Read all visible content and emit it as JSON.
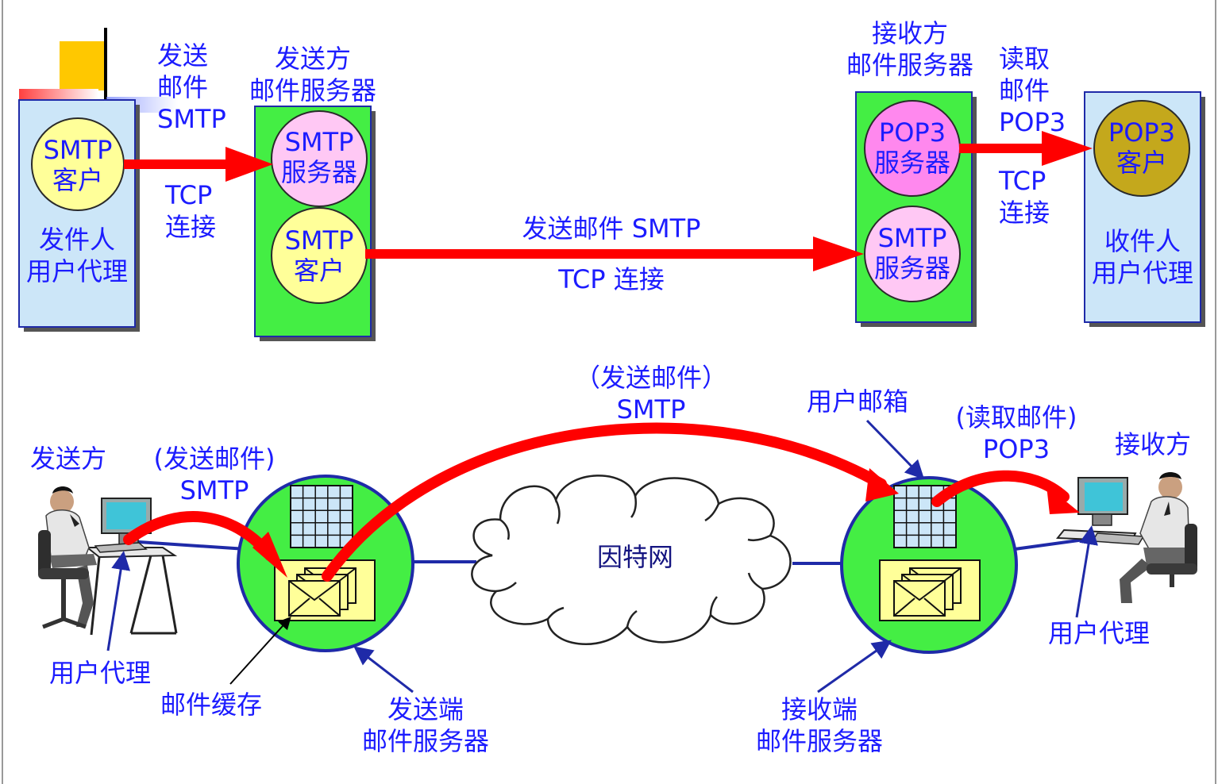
{
  "top": {
    "sender_ua": {
      "client": "SMTP\n客户",
      "caption": "发件人\n用户代理"
    },
    "sender_server": {
      "title": "发送方\n邮件服务器",
      "server": "SMTP\n服务器",
      "client": "SMTP\n客户"
    },
    "receiver_server": {
      "title": "接收方\n邮件服务器",
      "pop3": "POP3\n服务器",
      "smtp": "SMTP\n服务器"
    },
    "receiver_ua": {
      "client": "POP3\n客户",
      "caption": "收件人\n用户代理"
    },
    "link1_top": "发送\n邮件\nSMTP",
    "link1_bottom": "TCP\n连接",
    "link2_top": "发送邮件 SMTP",
    "link2_bottom": "TCP 连接",
    "link3_top": "读取\n邮件\nPOP3",
    "link3_bottom": "TCP\n连接"
  },
  "bottom": {
    "sender": "发送方",
    "send_mail_left": "(发送邮件)\nSMTP",
    "send_mail_center": "（发送邮件）\nSMTP",
    "internet": "因特网",
    "mailbox": "用户邮箱",
    "read_mail": "(读取邮件)\nPOP3",
    "receiver": "接收方",
    "ua_left": "用户代理",
    "mail_cache": "邮件缓存",
    "send_server": "发送端\n邮件服务器",
    "recv_server": "接收端\n邮件服务器",
    "ua_right": "用户代理"
  },
  "colors": {
    "label_blue": "#1c1cff",
    "arrow_red": "#ff0000",
    "server_green": "#44ee44",
    "ua_blue": "#cce6f8",
    "yellow_circle": "#ffff99",
    "pink_circle": "#ff88ee",
    "light_pink_circle": "#ffc8f4",
    "olive_circle": "#c4a81c"
  }
}
